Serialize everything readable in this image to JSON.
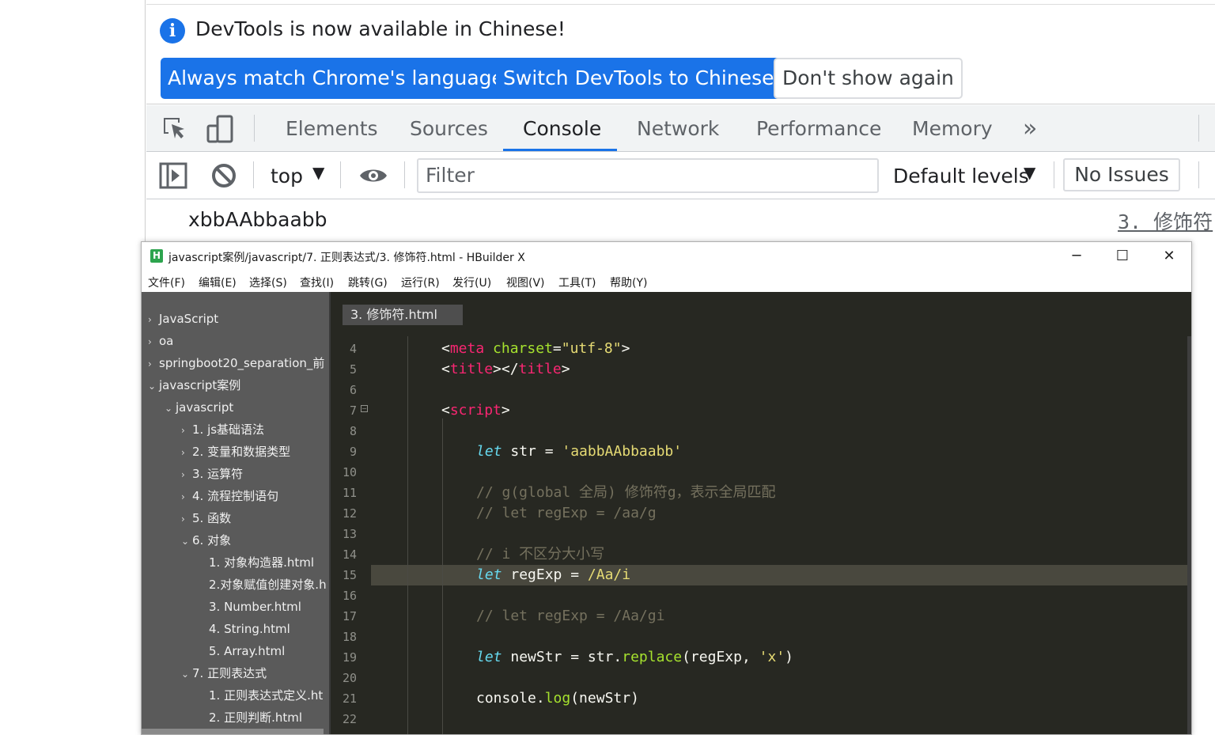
{
  "devtools": {
    "infobar": {
      "icon": "info-icon",
      "message": "DevTools is now available in Chinese!",
      "buttons": {
        "always_match": "Always match Chrome's language",
        "switch": "Switch DevTools to Chinese",
        "dont_show": "Don't show again"
      }
    },
    "tabs": [
      "Elements",
      "Sources",
      "Console",
      "Network",
      "Performance",
      "Memory"
    ],
    "active_tab": "Console",
    "console_toolbar": {
      "context": "top",
      "filter_placeholder": "Filter",
      "levels": "Default levels",
      "issues": "No Issues"
    },
    "log": {
      "message": "xbbAAbbaabb",
      "source": "3. 修饰符"
    },
    "colors": {
      "accent": "#1a73e8"
    }
  },
  "hbuilder": {
    "title": "javascript案例/javascript/7. 正则表达式/3. 修饰符.html - HBuilder X",
    "logo_letter": "H",
    "window_controls": {
      "minimize": "─",
      "maximize": "☐",
      "close": "✕"
    },
    "menu": [
      "文件(F)",
      "编辑(E)",
      "选择(S)",
      "查找(I)",
      "跳转(G)",
      "运行(R)",
      "发行(U)",
      "视图(V)",
      "工具(T)",
      "帮助(Y)"
    ],
    "tree": [
      {
        "label": "JavaScript",
        "level": 0,
        "arrow": "›"
      },
      {
        "label": "oa",
        "level": 0,
        "arrow": "›"
      },
      {
        "label": "springboot20_separation_前",
        "level": 0,
        "arrow": "›"
      },
      {
        "label": "javascript案例",
        "level": 0,
        "arrow": "⌄"
      },
      {
        "label": "javascript",
        "level": 1,
        "arrow": "⌄"
      },
      {
        "label": "1. js基础语法",
        "level": 2,
        "arrow": "›"
      },
      {
        "label": "2. 变量和数据类型",
        "level": 2,
        "arrow": "›"
      },
      {
        "label": "3. 运算符",
        "level": 2,
        "arrow": "›"
      },
      {
        "label": "4. 流程控制语句",
        "level": 2,
        "arrow": "›"
      },
      {
        "label": "5. 函数",
        "level": 2,
        "arrow": "›"
      },
      {
        "label": "6. 对象",
        "level": 2,
        "arrow": "⌄"
      },
      {
        "label": "1. 对象构造器.html",
        "level": 3,
        "arrow": ""
      },
      {
        "label": "2.对象赋值创建对象.h",
        "level": 3,
        "arrow": ""
      },
      {
        "label": "3. Number.html",
        "level": 3,
        "arrow": ""
      },
      {
        "label": "4. String.html",
        "level": 3,
        "arrow": ""
      },
      {
        "label": "5. Array.html",
        "level": 3,
        "arrow": ""
      },
      {
        "label": "7. 正则表达式",
        "level": 2,
        "arrow": "⌄"
      },
      {
        "label": "1. 正则表达式定义.ht",
        "level": 3,
        "arrow": ""
      },
      {
        "label": "2. 正则判断.html",
        "level": 3,
        "arrow": ""
      }
    ],
    "file_tab": "3. 修饰符.html",
    "line_numbers": [
      "4",
      "5",
      "6",
      "7",
      "8",
      "9",
      "10",
      "11",
      "12",
      "13",
      "14",
      "15",
      "16",
      "17",
      "18",
      "19",
      "20",
      "21",
      "22"
    ],
    "code": {
      "l4": {
        "lt": "<",
        "tag": "meta",
        "attr": "charset",
        "eq": "=",
        "val": "\"utf-8\"",
        "gt": ">"
      },
      "l5": {
        "lt": "<",
        "tag": "title",
        "mid": "></",
        "tag2": "title",
        "gt": ">"
      },
      "l7": {
        "lt": "<",
        "tag": "script",
        "gt": ">"
      },
      "l9": {
        "kw": "let",
        "rest": " str = ",
        "str": "'aabbAAbbaabb'"
      },
      "l11": "// g(global 全局) 修饰符g，表示全局匹配",
      "l12": "// let regExp = /aa/g",
      "l14": "// i 不区分大小写",
      "l15": {
        "kw": "let",
        "rest": " regExp = ",
        "re": "/Aa/i"
      },
      "l17": "// let regExp = /Aa/gi",
      "l19": {
        "kw": "let",
        "rest": " newStr = str.",
        "fn": "replace",
        "args": "(regExp, ",
        "str": "'x'",
        "close": ")"
      },
      "l21": {
        "obj": "console.",
        "fn": "log",
        "args": "(newStr)"
      }
    }
  }
}
